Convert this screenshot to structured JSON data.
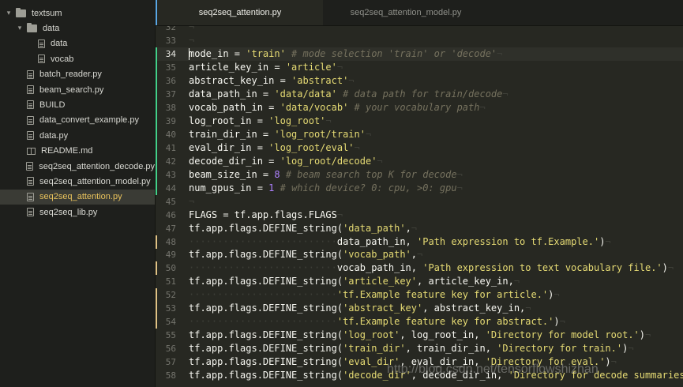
{
  "sidebar": {
    "items": [
      {
        "label": "textsum",
        "kind": "folder",
        "depth": 0,
        "expanded": true
      },
      {
        "label": "data",
        "kind": "folder",
        "depth": 1,
        "expanded": true
      },
      {
        "label": "data",
        "kind": "file",
        "depth": 2
      },
      {
        "label": "vocab",
        "kind": "file",
        "depth": 2
      },
      {
        "label": "batch_reader.py",
        "kind": "file",
        "depth": 1
      },
      {
        "label": "beam_search.py",
        "kind": "file",
        "depth": 1
      },
      {
        "label": "BUILD",
        "kind": "file",
        "depth": 1
      },
      {
        "label": "data_convert_example.py",
        "kind": "file",
        "depth": 1
      },
      {
        "label": "data.py",
        "kind": "file",
        "depth": 1
      },
      {
        "label": "README.md",
        "kind": "book",
        "depth": 1
      },
      {
        "label": "seq2seq_attention_decode.py",
        "kind": "file",
        "depth": 1
      },
      {
        "label": "seq2seq_attention_model.py",
        "kind": "file",
        "depth": 1
      },
      {
        "label": "seq2seq_attention.py",
        "kind": "file",
        "depth": 1,
        "selected": true
      },
      {
        "label": "seq2seq_lib.py",
        "kind": "file",
        "depth": 1
      }
    ]
  },
  "tabs": [
    {
      "label": "seq2seq_attention.py",
      "active": true
    },
    {
      "label": "seq2seq_attention_model.py",
      "active": false
    }
  ],
  "editor": {
    "eol_marker": "¬",
    "current_line": 34,
    "lines": [
      {
        "n": "32",
        "mark": "",
        "segs": []
      },
      {
        "n": "33",
        "mark": "",
        "segs": []
      },
      {
        "n": "34",
        "mark": "green",
        "segs": [
          [
            "",
            "mode_in = "
          ],
          [
            "str",
            "'train'"
          ],
          [
            "cmt",
            " # mode selection 'train' or 'decode'"
          ]
        ]
      },
      {
        "n": "35",
        "mark": "green",
        "segs": [
          [
            "",
            "article_key_in = "
          ],
          [
            "str",
            "'article'"
          ]
        ]
      },
      {
        "n": "36",
        "mark": "green",
        "segs": [
          [
            "",
            "abstract_key_in = "
          ],
          [
            "str",
            "'abstract'"
          ]
        ]
      },
      {
        "n": "37",
        "mark": "green",
        "segs": [
          [
            "",
            "data_path_in = "
          ],
          [
            "str",
            "'data/data'"
          ],
          [
            "cmt",
            " # data path for train/decode"
          ]
        ]
      },
      {
        "n": "38",
        "mark": "green",
        "segs": [
          [
            "",
            "vocab_path_in = "
          ],
          [
            "str",
            "'data/vocab'"
          ],
          [
            "cmt",
            " # your vocabulary path"
          ]
        ]
      },
      {
        "n": "39",
        "mark": "green",
        "segs": [
          [
            "",
            "log_root_in = "
          ],
          [
            "str",
            "'log_root'"
          ]
        ]
      },
      {
        "n": "40",
        "mark": "green",
        "segs": [
          [
            "",
            "train_dir_in = "
          ],
          [
            "str",
            "'log_root/train'"
          ]
        ]
      },
      {
        "n": "41",
        "mark": "green",
        "segs": [
          [
            "",
            "eval_dir_in = "
          ],
          [
            "str",
            "'log_root/eval'"
          ]
        ]
      },
      {
        "n": "42",
        "mark": "green",
        "segs": [
          [
            "",
            "decode_dir_in = "
          ],
          [
            "str",
            "'log_root/decode'"
          ]
        ]
      },
      {
        "n": "43",
        "mark": "green",
        "segs": [
          [
            "",
            "beam_size_in = "
          ],
          [
            "num",
            "8"
          ],
          [
            "cmt",
            " # beam search top K for decode"
          ]
        ]
      },
      {
        "n": "44",
        "mark": "green",
        "segs": [
          [
            "",
            "num_gpus_in = "
          ],
          [
            "num",
            "1"
          ],
          [
            "cmt",
            " # which device? 0: cpu, >0: gpu"
          ]
        ]
      },
      {
        "n": "45",
        "mark": "",
        "segs": []
      },
      {
        "n": "46",
        "mark": "",
        "segs": [
          [
            "",
            "FLAGS = tf.app.flags.FLAGS"
          ]
        ]
      },
      {
        "n": "47",
        "mark": "",
        "segs": [
          [
            "",
            "tf.app.flags.DEFINE_string("
          ],
          [
            "str",
            "'data_path'"
          ],
          [
            "",
            ","
          ]
        ]
      },
      {
        "n": "48",
        "mark": "yellow",
        "segs": [
          [
            "dots",
            "··························"
          ],
          [
            "",
            "data_path_in, "
          ],
          [
            "str",
            "'Path expression to tf.Example.'"
          ],
          [
            "",
            ")"
          ]
        ]
      },
      {
        "n": "49",
        "mark": "",
        "segs": [
          [
            "",
            "tf.app.flags.DEFINE_string("
          ],
          [
            "str",
            "'vocab_path'"
          ],
          [
            "",
            ","
          ]
        ]
      },
      {
        "n": "50",
        "mark": "yellow",
        "segs": [
          [
            "dots",
            "··························"
          ],
          [
            "",
            "vocab_path_in, "
          ],
          [
            "str",
            "'Path expression to text vocabulary file.'"
          ],
          [
            "",
            ")"
          ]
        ]
      },
      {
        "n": "51",
        "mark": "",
        "segs": [
          [
            "",
            "tf.app.flags.DEFINE_string("
          ],
          [
            "str",
            "'article_key'"
          ],
          [
            "",
            ", article_key_in,"
          ]
        ]
      },
      {
        "n": "52",
        "mark": "yellow",
        "segs": [
          [
            "dots",
            "··························"
          ],
          [
            "str",
            "'tf.Example feature key for article.'"
          ],
          [
            "",
            ")"
          ]
        ]
      },
      {
        "n": "53",
        "mark": "yellow",
        "segs": [
          [
            "",
            "tf.app.flags.DEFINE_string("
          ],
          [
            "str",
            "'abstract_key'"
          ],
          [
            "",
            ", abstract_key_in,"
          ]
        ]
      },
      {
        "n": "54",
        "mark": "yellow",
        "segs": [
          [
            "dots",
            "··························"
          ],
          [
            "str",
            "'tf.Example feature key for abstract.'"
          ],
          [
            "",
            ")"
          ]
        ]
      },
      {
        "n": "55",
        "mark": "",
        "segs": [
          [
            "",
            "tf.app.flags.DEFINE_string("
          ],
          [
            "str",
            "'log_root'"
          ],
          [
            "",
            ", log_root_in, "
          ],
          [
            "str",
            "'Directory for model root.'"
          ],
          [
            "",
            ")"
          ]
        ]
      },
      {
        "n": "56",
        "mark": "",
        "segs": [
          [
            "",
            "tf.app.flags.DEFINE_string("
          ],
          [
            "str",
            "'train_dir'"
          ],
          [
            "",
            ", train_dir_in, "
          ],
          [
            "str",
            "'Directory for train.'"
          ],
          [
            "",
            ")"
          ]
        ]
      },
      {
        "n": "57",
        "mark": "",
        "segs": [
          [
            "",
            "tf.app.flags.DEFINE_string("
          ],
          [
            "str",
            "'eval_dir'"
          ],
          [
            "",
            ", eval_dir_in, "
          ],
          [
            "str",
            "'Directory for eval.'"
          ],
          [
            "",
            ")"
          ]
        ]
      },
      {
        "n": "58",
        "mark": "",
        "segs": [
          [
            "",
            "tf.app.flags.DEFINE_string("
          ],
          [
            "str",
            "'decode_dir'"
          ],
          [
            "",
            ", decode_dir_in, "
          ],
          [
            "str",
            "'Directory for decode summaries.'"
          ],
          [
            "",
            ")"
          ]
        ]
      }
    ]
  },
  "watermark": "http://blog.csdn.net/tensorflowshizhan",
  "colors": {
    "accent": "#5aa7e5",
    "selected_text": "#e8c25c",
    "git_added": "#43d08a",
    "git_modified": "#e0c285",
    "string": "#e6db74",
    "number": "#ae81ff",
    "comment": "#75715e"
  }
}
